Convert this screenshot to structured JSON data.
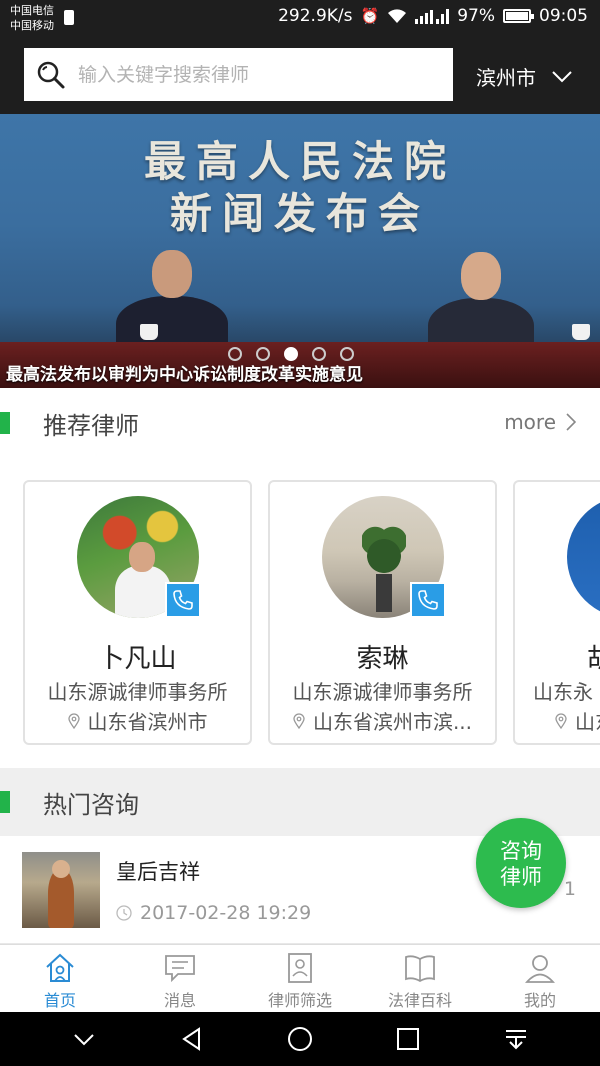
{
  "status_bar": {
    "carrier_1": "中国电信",
    "carrier_2": "中国移动",
    "net_speed": "292.9K/s",
    "battery_percent": "97%",
    "time": "09:05"
  },
  "search": {
    "placeholder": "输入关键字搜索律师",
    "city": "滨州市"
  },
  "banner": {
    "headline_1": "最高人民法院",
    "headline_2": "新闻发布会",
    "caption": "最高法发布以审判为中心诉讼制度改革实施意见",
    "slide_count": 5,
    "active_slide": 3
  },
  "recommend": {
    "title": "推荐律师",
    "more_label": "more",
    "lawyers": [
      {
        "name": "卜凡山",
        "firm": "山东源诚律师事务所",
        "location": "山东省滨州市"
      },
      {
        "name": "索琳",
        "firm": "山东源诚律师事务所",
        "location": "山东省滨州市滨..."
      },
      {
        "name": "胡",
        "firm": "山东永",
        "location": "山东"
      }
    ]
  },
  "hot": {
    "title": "热门咨询",
    "items": [
      {
        "title": "皇后吉祥",
        "time": "2017-02-28 19:29",
        "count": "1"
      }
    ]
  },
  "fab": {
    "line_1": "咨询",
    "line_2": "律师"
  },
  "tabs": [
    {
      "label": "首页",
      "icon": "home-icon",
      "active": true
    },
    {
      "label": "消息",
      "icon": "message-icon",
      "active": false
    },
    {
      "label": "律师筛选",
      "icon": "lawyer-filter-icon",
      "active": false
    },
    {
      "label": "法律百科",
      "icon": "book-icon",
      "active": false
    },
    {
      "label": "我的",
      "icon": "profile-icon",
      "active": false
    }
  ],
  "colors": {
    "accent_green": "#2dbb4e",
    "section_bar": "#22b34a",
    "active_tab": "#2a8bd4",
    "header_bg": "#1e1e1e"
  }
}
